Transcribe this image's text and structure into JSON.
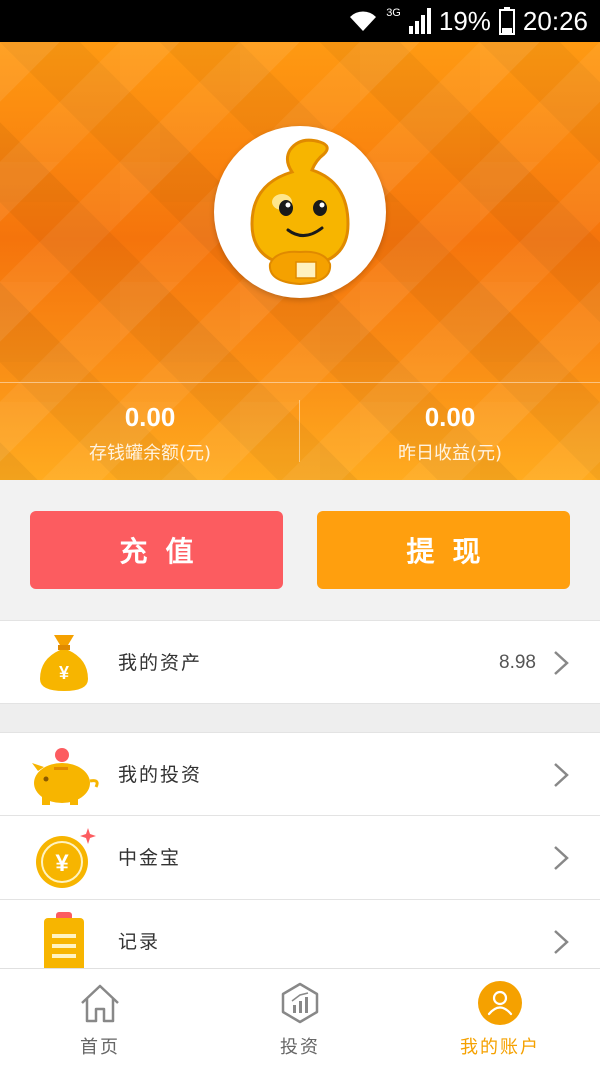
{
  "status_bar": {
    "network": "3G",
    "battery": "19%",
    "time": "20:26"
  },
  "header": {
    "balance": {
      "value": "0.00",
      "label": "存钱罐余额(元)"
    },
    "yesterday": {
      "value": "0.00",
      "label": "昨日收益(元)"
    }
  },
  "actions": {
    "recharge": "充值",
    "withdraw": "提现"
  },
  "menu": {
    "assets": {
      "label": "我的资产",
      "value": "8.98"
    },
    "invest": {
      "label": "我的投资"
    },
    "gold": {
      "label": "中金宝"
    },
    "records": {
      "label": "记录"
    }
  },
  "tabs": [
    {
      "label": "首页",
      "icon": "home-icon"
    },
    {
      "label": "投资",
      "icon": "invest-icon"
    },
    {
      "label": "我的账户",
      "icon": "account-icon"
    }
  ],
  "colors": {
    "accent": "#f5a100",
    "recharge": "#fc5c60",
    "withdraw": "#ff9f0e"
  }
}
